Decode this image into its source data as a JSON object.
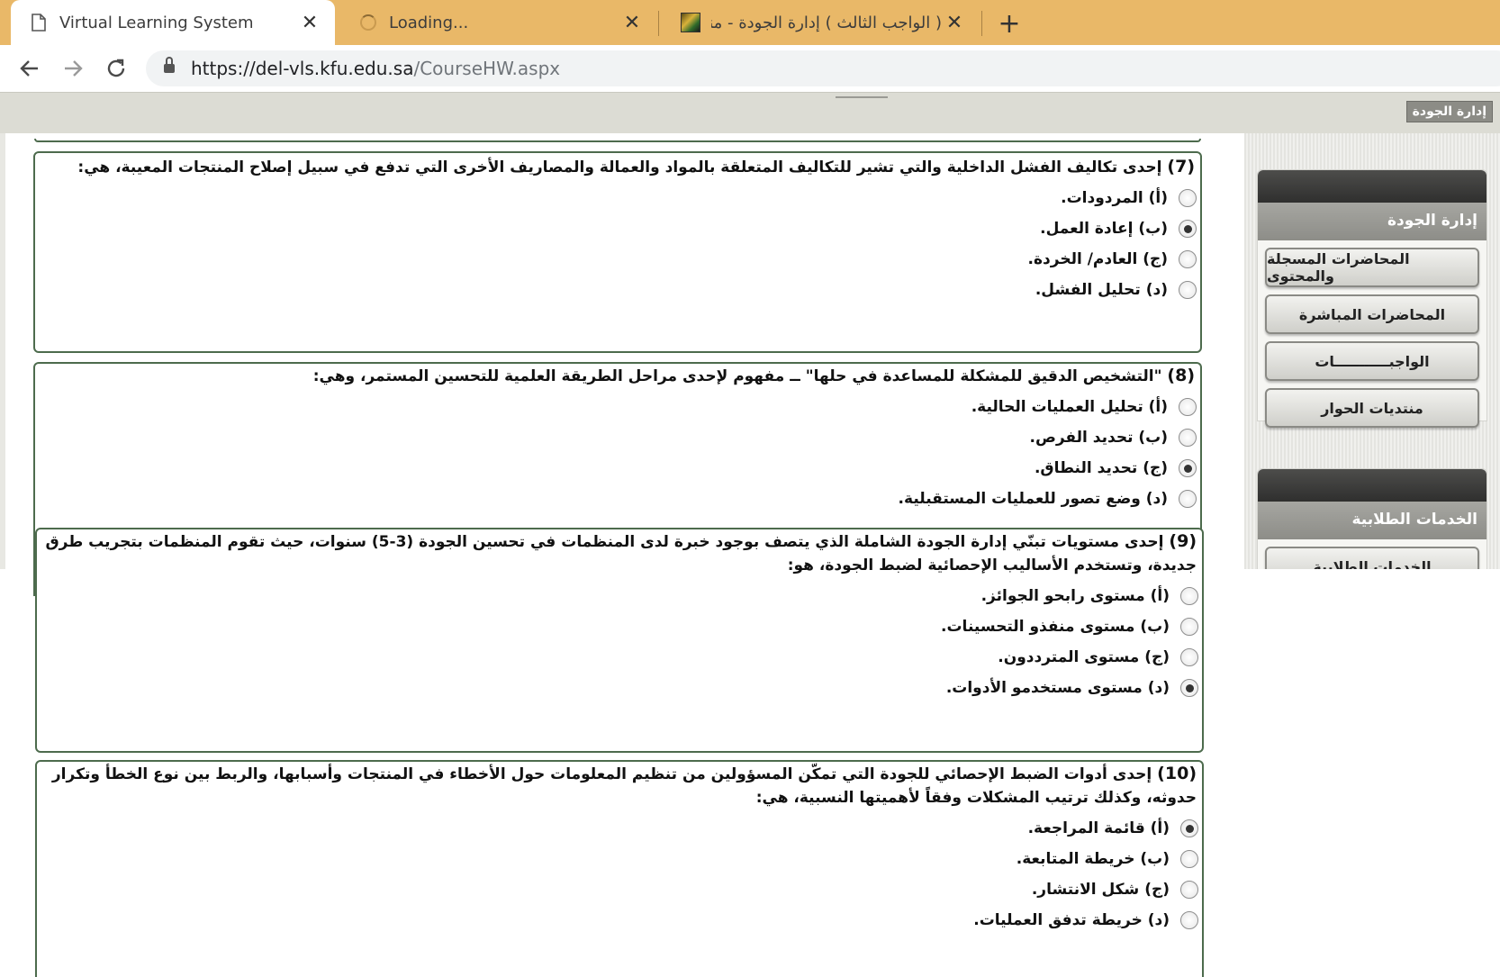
{
  "browser": {
    "tabs": [
      {
        "title": "Virtual Learning System",
        "icon": "page-icon"
      },
      {
        "title": "Loading...",
        "icon": "spinner-icon"
      },
      {
        "title": "( الواجب الثالث ) إدارة الجودة - منتد",
        "icon": "forum-favicon"
      }
    ],
    "close_glyph": "✕",
    "new_tab_glyph": "+",
    "url_host": "https://del-vls.kfu.edu.sa",
    "url_path": "/CourseHW.aspx"
  },
  "header": {
    "course_title": "إدارة الجودة"
  },
  "sidebar": {
    "panel1": {
      "title": "إدارة الجودة",
      "buttons": [
        "المحاضرات المسجلة والمحتوى",
        "المحاضرات المباشرة",
        "الواجبـــــــــــات",
        "منتديات الحوار"
      ]
    },
    "panel2": {
      "title": "الخدمات الطلابية",
      "buttons": [
        "الخدمات الطلابية"
      ]
    }
  },
  "questions": [
    {
      "number": "(7)",
      "text": "إحدى تكاليف الفشل الداخلية والتي تشير للتكاليف المتعلقة بالمواد والعمالة والمصاريف الأخرى التي تدفع في سبيل إصلاح المنتجات المعيبة، هي:",
      "options": [
        "(أ) المردودات.",
        "(ب) إعادة العمل.",
        "(ج) العادم/ الخردة.",
        "(د) تحليل الفشل."
      ],
      "selected": 1
    },
    {
      "number": "(8)",
      "text": "\"التشخيص الدقيق للمشكلة للمساعدة في حلها\" ــ مفهوم لإحدى مراحل الطريقة العلمية للتحسين المستمر، وهي:",
      "options": [
        "(أ) تحليل العمليات الحالية.",
        "(ب) تحديد الفرص.",
        "(ج) تحديد النطاق.",
        "(د) وضع تصور للعمليات المستقبلية."
      ],
      "selected": 2
    },
    {
      "number": "(9)",
      "text": "إحدى مستويات تبنّي إدارة الجودة الشاملة الذي يتصف بوجود خبرة لدى المنظمات في تحسين الجودة (3-5) سنوات، حيث تقوم المنظمات بتجريب طرق جديدة، وتستخدم الأساليب الإحصائية لضبط الجودة، هو:",
      "options": [
        "(أ) مستوى رابحو الجوائز.",
        "(ب) مستوى منفذو التحسينات.",
        "(ج) مستوى المترددون.",
        "(د) مستوى مستخدمو الأدوات."
      ],
      "selected": 3
    },
    {
      "number": "(10)",
      "text": "إحدى أدوات الضبط الإحصائي للجودة التي تمكّن المسؤولين من تنظيم المعلومات حول الأخطاء في المنتجات وأسبابها، والربط بين نوع الخطأ وتكرار حدوثه، وكذلك ترتيب المشكلات وفقاً لأهميتها النسبية، هي:",
      "options": [
        "(أ) قائمة المراجعة.",
        "(ب) خريطة المتابعة.",
        "(ج) شكل الانتشار.",
        "(د) خريطة تدفق العمليات."
      ],
      "selected": 0
    }
  ]
}
